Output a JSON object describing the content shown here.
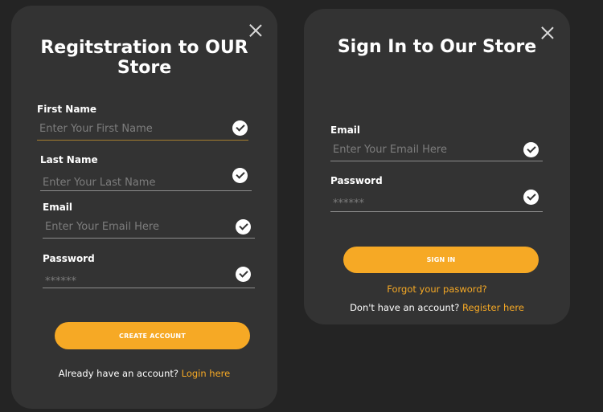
{
  "registration": {
    "title_line1": "Regitstration to OUR",
    "title_line2": "Store",
    "fields": [
      {
        "label": "First Name",
        "placeholder": "Enter Your First Name"
      },
      {
        "label": "Last Name",
        "placeholder": "Enter Your Last Name"
      },
      {
        "label": "Email",
        "placeholder": "Enter Your Email Here"
      },
      {
        "label": "Password",
        "placeholder": "******"
      }
    ],
    "button_label": "CREATE ACCOUNT",
    "footer_text": "Already have an account?",
    "footer_link": "Login here"
  },
  "signin": {
    "title": "Sign In to Our Store",
    "fields": [
      {
        "label": "Email",
        "placeholder": "Enter Your Email Here"
      },
      {
        "label": "Password",
        "placeholder": "******"
      }
    ],
    "button_label": "SIGN IN",
    "forgot_link": "Forgot your pasword?",
    "footer_text": "Don't have an account?",
    "footer_link": "Register here"
  },
  "icons": {
    "close": "close-icon",
    "check": "check-circle-icon"
  },
  "colors": {
    "background": "#242424",
    "card": "#333333",
    "accent": "#f6a925",
    "text": "#ffffff",
    "placeholder": "#7d7d7d"
  }
}
